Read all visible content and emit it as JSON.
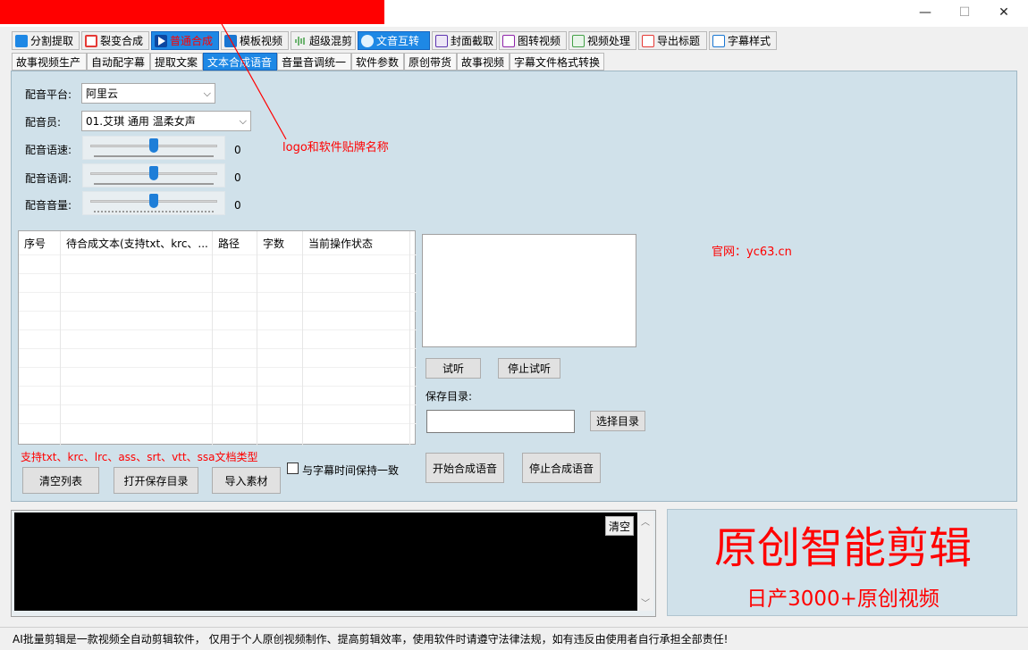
{
  "window": {
    "controls": {
      "minimize": "—",
      "maximize": "☐",
      "close": "✕"
    }
  },
  "main_tabs": [
    {
      "label": "分割提取",
      "icon": "split-icon"
    },
    {
      "label": "裂变合成",
      "icon": "copy-icon"
    },
    {
      "label": "普通合成",
      "icon": "play-icon"
    },
    {
      "label": "模板视频",
      "icon": "book-icon"
    },
    {
      "label": "超级混剪",
      "icon": "waveform-icon"
    },
    {
      "label": "文音互转",
      "icon": "microphone-icon"
    },
    {
      "label": "封面截取",
      "icon": "image-icon"
    },
    {
      "label": "图转视频",
      "icon": "video-icon"
    },
    {
      "label": "视频处理",
      "icon": "compare-icon"
    },
    {
      "label": "导出标题",
      "icon": "export-icon"
    },
    {
      "label": "字幕样式",
      "icon": "subtitle-icon"
    }
  ],
  "sub_tabs": [
    "故事视频生产",
    "自动配字幕",
    "提取文案",
    "文本合成语音",
    "音量音调统一",
    "软件参数",
    "原创带货",
    "故事视频",
    "字幕文件格式转换"
  ],
  "form": {
    "platform_label": "配音平台:",
    "platform_value": "阿里云",
    "voice_label": "配音员:",
    "voice_value": "01.艾琪 通用 温柔女声",
    "speed_label": "配音语速:",
    "speed_value": "0",
    "pitch_label": "配音语调:",
    "pitch_value": "0",
    "volume_label": "配音音量:",
    "volume_value": "0"
  },
  "annotation": {
    "logo_note": "logo和软件贴牌名称",
    "website": "官网：yc63.cn"
  },
  "table": {
    "columns": [
      "序号",
      "待合成文本(支持txt、krc、...",
      "路径",
      "字数",
      "当前操作状态"
    ],
    "rows": []
  },
  "supported_formats": "支持txt、krc、lrc、ass、srt、vtt、ssa文档类型",
  "buttons": {
    "clear_list": "清空列表",
    "open_save_dir": "打开保存目录",
    "import_material": "导入素材",
    "keep_sync": "与字幕时间保持一致",
    "preview": "试听",
    "stop_preview": "停止试听",
    "save_dir_label": "保存目录:",
    "choose_dir": "选择目录",
    "start_synth": "开始合成语音",
    "stop_synth": "停止合成语音",
    "clear_log": "清空"
  },
  "banner": {
    "title": "原创智能剪辑",
    "subtitle": "日产3000+原创视频"
  },
  "status_text": "AI批量剪辑是一款视频全自动剪辑软件， 仅用于个人原创视频制作、提高剪辑效率，使用软件时请遵守法律法规，如有违反由使用者自行承担全部责任!",
  "colors": {
    "accent_blue": "#1e88e5",
    "highlight_red": "#ff0000",
    "panel_bg": "#d0e1ea"
  }
}
